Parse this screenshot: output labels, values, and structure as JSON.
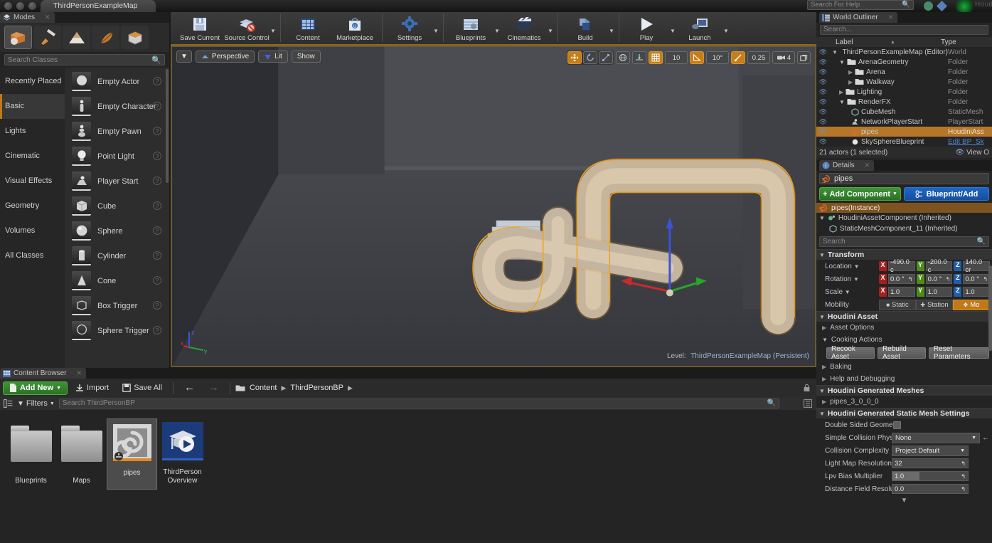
{
  "titlebar": {
    "map_tab": "ThirdPersonExampleMap",
    "search_help_placeholder": "Search For Help",
    "brand": "Houdini"
  },
  "modes": {
    "tab_label": "Modes",
    "mode_buttons": [
      {
        "name": "place-mode",
        "icon": "cube-icon",
        "selected": true
      },
      {
        "name": "paint-mode",
        "icon": "brush-icon",
        "selected": false
      },
      {
        "name": "landscape-mode",
        "icon": "mountain-icon",
        "selected": false
      },
      {
        "name": "foliage-mode",
        "icon": "leaf-icon",
        "selected": false
      },
      {
        "name": "geometry-edit-mode",
        "icon": "box-edit-icon",
        "selected": false
      }
    ],
    "search_placeholder": "Search Classes",
    "categories": [
      {
        "label": "Recently Placed",
        "selected": false
      },
      {
        "label": "Basic",
        "selected": true
      },
      {
        "label": "Lights",
        "selected": false
      },
      {
        "label": "Cinematic",
        "selected": false
      },
      {
        "label": "Visual Effects",
        "selected": false
      },
      {
        "label": "Geometry",
        "selected": false
      },
      {
        "label": "Volumes",
        "selected": false
      },
      {
        "label": "All Classes",
        "selected": false
      }
    ],
    "items": [
      {
        "label": "Empty Actor"
      },
      {
        "label": "Empty Character"
      },
      {
        "label": "Empty Pawn"
      },
      {
        "label": "Point Light"
      },
      {
        "label": "Player Start"
      },
      {
        "label": "Cube"
      },
      {
        "label": "Sphere"
      },
      {
        "label": "Cylinder"
      },
      {
        "label": "Cone"
      },
      {
        "label": "Box Trigger"
      },
      {
        "label": "Sphere Trigger"
      }
    ]
  },
  "toolbar": [
    {
      "label": "Save Current",
      "icon": "save-icon",
      "dropdown": false
    },
    {
      "label": "Source Control",
      "icon": "source-control-icon",
      "dropdown": true
    },
    {
      "label": "Content",
      "icon": "content-icon",
      "dropdown": false
    },
    {
      "label": "Marketplace",
      "icon": "marketplace-icon",
      "dropdown": false
    },
    {
      "label": "Settings",
      "icon": "settings-icon",
      "dropdown": true
    },
    {
      "label": "Blueprints",
      "icon": "blueprints-icon",
      "dropdown": true
    },
    {
      "label": "Cinematics",
      "icon": "cinematics-icon",
      "dropdown": true
    },
    {
      "label": "Build",
      "icon": "build-icon",
      "dropdown": true
    },
    {
      "label": "Play",
      "icon": "play-icon",
      "dropdown": true
    },
    {
      "label": "Launch",
      "icon": "launch-icon",
      "dropdown": true
    }
  ],
  "viewport": {
    "menu_icon": "chevron-down-icon",
    "perspective_label": "Perspective",
    "lit_label": "Lit",
    "show_label": "Show",
    "transform_tools": [
      {
        "name": "translate-tool",
        "icon": "move-icon",
        "active": true
      },
      {
        "name": "rotate-tool",
        "icon": "rotate-icon",
        "active": false
      },
      {
        "name": "scale-tool",
        "icon": "scale-icon",
        "active": false
      }
    ],
    "coord_system": {
      "name": "world-space-toggle",
      "icon": "globe-icon",
      "active": false
    },
    "surface_snap": {
      "name": "surface-snap-toggle",
      "icon": "surface-snap-icon",
      "active": false
    },
    "grid_snap": {
      "name": "grid-snap-toggle",
      "icon": "grid-icon",
      "active": true,
      "value": "10"
    },
    "rotation_snap": {
      "name": "rotation-snap-toggle",
      "icon": "angle-icon",
      "active": true,
      "value": "10°"
    },
    "scale_snap": {
      "name": "scale-snap-toggle",
      "icon": "scale-snap-icon",
      "active": true,
      "value": "0.25"
    },
    "camera_speed": {
      "name": "camera-speed",
      "icon": "camera-icon",
      "value": "4"
    },
    "maximize": {
      "name": "maximize-viewport-button",
      "icon": "maximize-icon"
    },
    "level_prefix": "Level:",
    "level_name": "ThirdPersonExampleMap (Persistent)",
    "axis_labels": {
      "x": "x",
      "y": "y",
      "z": "z"
    }
  },
  "content_browser": {
    "tab_label": "Content Browser",
    "add_new_label": "Add New",
    "import_label": "Import",
    "save_all_label": "Save All",
    "breadcrumb": [
      "Content",
      "ThirdPersonBP"
    ],
    "filters_label": "Filters",
    "search_placeholder": "Search ThirdPersonBP",
    "assets": [
      {
        "name": "Blueprints",
        "kind": "folder",
        "selected": false
      },
      {
        "name": "Maps",
        "kind": "folder",
        "selected": false
      },
      {
        "name": "pipes",
        "kind": "houdini-asset",
        "selected": true
      },
      {
        "name": "ThirdPerson Overview",
        "name_line1": "ThirdPerson",
        "name_line2": "Overview",
        "kind": "tutorial",
        "selected": false
      }
    ]
  },
  "world_outliner": {
    "tab_label": "World Outliner",
    "search_placeholder": "Search...",
    "columns": {
      "label": "Label",
      "type": "Type"
    },
    "rows": [
      {
        "label": "ThirdPersonExampleMap (Editor)",
        "type": "World",
        "depth": 0,
        "icon": "world-icon",
        "expander": "down",
        "selected": false
      },
      {
        "label": "ArenaGeometry",
        "type": "Folder",
        "depth": 1,
        "icon": "folder-icon",
        "expander": "down",
        "selected": false
      },
      {
        "label": "Arena",
        "type": "Folder",
        "depth": 2,
        "icon": "folder-icon",
        "expander": "right",
        "selected": false
      },
      {
        "label": "Walkway",
        "type": "Folder",
        "depth": 2,
        "icon": "folder-icon",
        "expander": "right",
        "selected": false
      },
      {
        "label": "Lighting",
        "type": "Folder",
        "depth": 1,
        "icon": "folder-icon",
        "expander": "right",
        "selected": false
      },
      {
        "label": "RenderFX",
        "type": "Folder",
        "depth": 1,
        "icon": "folder-icon",
        "expander": "down",
        "selected": false
      },
      {
        "label": "CubeMesh",
        "type": "StaticMesh",
        "depth": 2,
        "icon": "mesh-icon",
        "expander": "none",
        "selected": false
      },
      {
        "label": "NetworkPlayerStart",
        "type": "PlayerStart",
        "depth": 2,
        "icon": "playerstart-icon",
        "expander": "none",
        "selected": false
      },
      {
        "label": "pipes",
        "type": "HoudiniAss",
        "depth": 2,
        "icon": "houdini-icon",
        "expander": "none",
        "selected": true
      },
      {
        "label": "SkySphereBlueprint",
        "type": "Edit BP_Sk",
        "depth": 2,
        "icon": "sphere-icon",
        "expander": "none",
        "selected": false,
        "type_is_link": true
      }
    ],
    "footer_count": "21 actors (1 selected)",
    "footer_view": "View O"
  },
  "details": {
    "tab_label": "Details",
    "actor_name": "pipes",
    "add_component_label": "Add Component",
    "blueprint_label": "Blueprint/Add",
    "component_root": "pipes(Instance)",
    "components": [
      {
        "label": "HoudiniAssetComponent (Inherited)",
        "depth": 0,
        "icon": "component-icon"
      },
      {
        "label": "StaticMeshComponent_11 (Inherited)",
        "depth": 1,
        "icon": "mesh-icon"
      }
    ],
    "search_placeholder": "Search",
    "transform": {
      "header": "Transform",
      "rows": [
        {
          "label": "Location",
          "x": "-490.0 c",
          "y": "-200.0 c",
          "z": "140.0 cr"
        },
        {
          "label": "Rotation",
          "x": "0.0 °",
          "y": "0.0 °",
          "z": "0.0 °"
        },
        {
          "label": "Scale",
          "x": "1.0",
          "y": "1.0",
          "z": "1.0"
        }
      ],
      "mobility_label": "Mobility",
      "mobility_options": [
        {
          "label": "Static",
          "active": false
        },
        {
          "label": "Station",
          "active": false
        },
        {
          "label": "Mo",
          "active": true
        }
      ]
    },
    "houdini_asset": {
      "header": "Houdini Asset",
      "asset_options_label": "Asset Options",
      "cooking_actions_label": "Cooking Actions",
      "buttons": [
        "Recook Asset",
        "Rebuild Asset",
        "Reset Parameters"
      ],
      "baking_label": "Baking",
      "help_label": "Help and Debugging"
    },
    "generated_meshes": {
      "header": "Houdini Generated Meshes",
      "items": [
        "pipes_3_0_0_0"
      ]
    },
    "static_mesh_settings": {
      "header": "Houdini Generated Static Mesh Settings",
      "rows": [
        {
          "label": "Double Sided Geometi",
          "type": "checkbox",
          "value": ""
        },
        {
          "label": "Simple Collision Phys",
          "type": "dropdown-reset",
          "value": "None"
        },
        {
          "label": "Collision Complexity",
          "type": "dropdown-short",
          "value": "Project Default"
        },
        {
          "label": "Light Map Resolution",
          "type": "number",
          "value": "32"
        },
        {
          "label": "Lpv Bias Multiplier",
          "type": "slider",
          "value": "1.0"
        },
        {
          "label": "Distance Field Resolu",
          "type": "number",
          "value": "0.0"
        }
      ]
    }
  }
}
